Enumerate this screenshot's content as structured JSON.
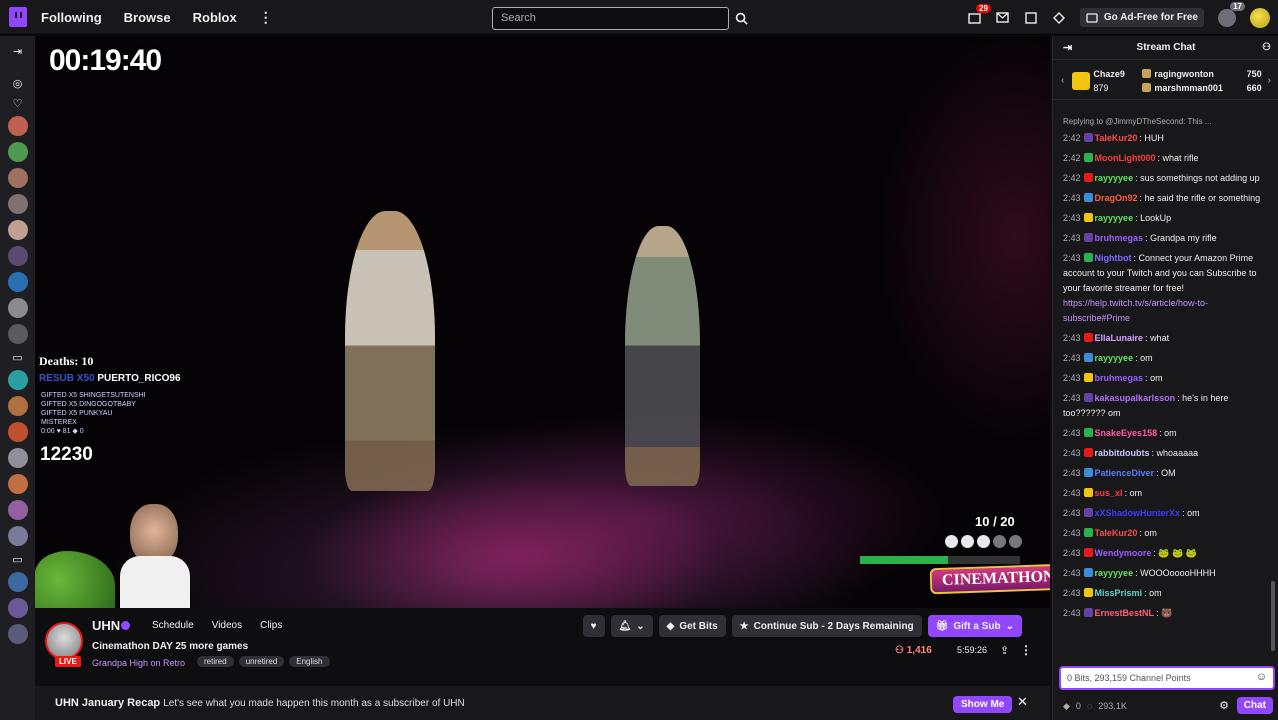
{
  "nav": {
    "links": [
      "Following",
      "Browse",
      "Roblox"
    ],
    "more": "⋮",
    "search_placeholder": "Search",
    "notif_count": "29",
    "adfree": "Go Ad-Free for Free",
    "bits_count": "17"
  },
  "video": {
    "timer": "00:19:40",
    "deaths": "Deaths: 10",
    "resub_prefix": "RESUB X50",
    "resub_name": "PUERTO_RICO96",
    "gifts": [
      "GIFTED X5 SHINGETSUTENSHI",
      "GIFTED X5 DINGOGOTBABY",
      "GIFTED X5 PUNKYAU",
      "MISTEREX",
      "0:00 ♥ 81 ◆ 0"
    ],
    "counter": "12230",
    "progress": "10 / 20",
    "health_fraction": 0.55,
    "logo": "CINEMATHON"
  },
  "channel": {
    "name": "UHN",
    "tabs": [
      "Schedule",
      "Videos",
      "Clips"
    ],
    "live": "LIVE",
    "title": "Cinemathon DAY 25 more games",
    "game": "Grandpa High on Retro",
    "tags": [
      "retired",
      "unretired",
      "English"
    ],
    "get_bits": "Get Bits",
    "continue_sub": "Continue Sub - 2 Days Remaining",
    "gift_sub": "Gift a Sub",
    "viewers": "1,416",
    "uptime": "5:59:26"
  },
  "recap": {
    "title": "UHN January Recap",
    "text": "Let's see what you made happen this month as a subscriber of UHN",
    "button": "Show Me"
  },
  "chat": {
    "header": "Stream Chat",
    "leaderboard": {
      "first_name": "Chaze9",
      "first_value": "879",
      "rows": [
        {
          "name": "ragingwonton",
          "value": "750"
        },
        {
          "name": "marshmman001",
          "value": "660"
        }
      ]
    },
    "messages": [
      {
        "reply": "Replying to @JimmyDTheSecond: This ...",
        "time": "2:42",
        "user": "TaleKur20",
        "color": "#ff4a4a",
        "text": "HUH"
      },
      {
        "time": "2:42",
        "user": "MoonLight000",
        "color": "#ff3b3b",
        "text": "what rifle"
      },
      {
        "time": "2:42",
        "user": "rayyyyee",
        "color": "#5fe35f",
        "text": "sus somethings not adding up"
      },
      {
        "time": "2:43",
        "user": "DragOn92",
        "color": "#ff5e3a",
        "text": "he said the rifle or something"
      },
      {
        "time": "2:43",
        "user": "rayyyyee",
        "color": "#5fe35f",
        "text": "LookUp"
      },
      {
        "time": "2:43",
        "user": "bruhmegas",
        "color": "#9b5cff",
        "text": "Grandpa my rifle"
      },
      {
        "time": "2:43",
        "user": "Nightbot",
        "color": "#7a6bff",
        "text": "Connect your Amazon Prime account to your Twitch and you can Subscribe to your favorite streamer for free!",
        "link": "https://help.twitch.tv/s/article/how-to-subscribe#Prime"
      },
      {
        "time": "2:43",
        "user": "EllaLunaire",
        "color": "#d6a0ff",
        "text": "what"
      },
      {
        "time": "2:43",
        "user": "rayyyyee",
        "color": "#5fe35f",
        "text": "om"
      },
      {
        "time": "2:43",
        "user": "bruhmegas",
        "color": "#9b5cff",
        "text": "om"
      },
      {
        "time": "2:43",
        "user": "kakasupalkarlsson",
        "color": "#b46bff",
        "text": "he's in here too?????? om"
      },
      {
        "time": "2:43",
        "user": "SnakeEyes158",
        "color": "#ff5aa0",
        "text": "om"
      },
      {
        "time": "2:43",
        "user": "rabbitdoubts",
        "color": "#c8c8ff",
        "text": "whoaaaaa"
      },
      {
        "time": "2:43",
        "user": "PatienceDiver",
        "color": "#5b7bff",
        "text": "OM"
      },
      {
        "time": "2:43",
        "user": "sus_xl",
        "color": "#ff3b3b",
        "text": "om"
      },
      {
        "time": "2:43",
        "user": "xXShadowHunterXx",
        "color": "#3a3aff",
        "text": "om"
      },
      {
        "time": "2:43",
        "user": "TaleKur20",
        "color": "#ff4a4a",
        "text": "om"
      },
      {
        "time": "2:43",
        "user": "Wendymoore",
        "color": "#9b5cff",
        "text": "🐸 🐸 🐸"
      },
      {
        "time": "2:43",
        "user": "rayyyyee",
        "color": "#5fe35f",
        "text": "WOOOooooHHHH"
      },
      {
        "time": "2:43",
        "user": "MissPrismi",
        "color": "#5fd0c8",
        "text": "om"
      },
      {
        "time": "2:43",
        "user": "ErnestBestNL",
        "color": "#ff5e7a",
        "text": "🐻"
      }
    ],
    "input_placeholder": "0 Bits, 293,159 Channel Points",
    "points_bits": "0",
    "points": "293.1K",
    "chat_button": "Chat"
  },
  "colors": {
    "accent": "#9147ff",
    "live": "#e91916"
  }
}
